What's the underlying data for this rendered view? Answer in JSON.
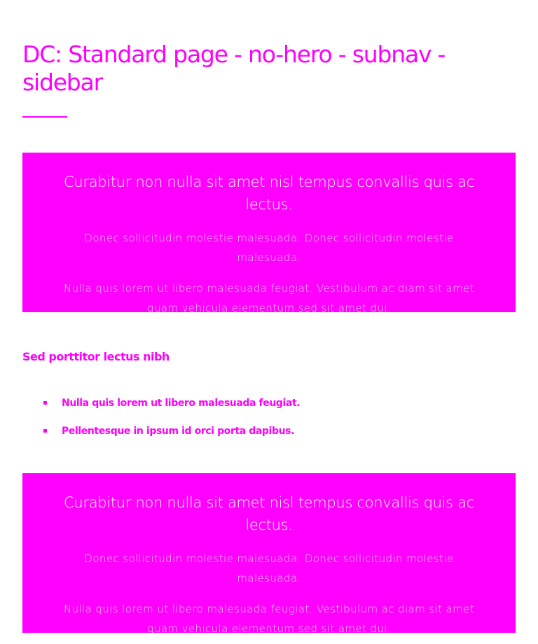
{
  "page": {
    "title": "DC: Standard page - no-hero - subnav - sidebar"
  },
  "callouts": [
    {
      "heading": "Curabitur non nulla sit amet nisl tempus convallis quis ac lectus.",
      "text1": "Donec sollicitudin molestie malesuada. Donec sollicitudin molestie malesuada.",
      "text2": "Nulla quis lorem ut libero malesuada feugiat. Vestibulum ac diam sit amet quam vehicula elementum sed sit amet dui."
    },
    {
      "heading": "Curabitur non nulla sit amet nisl tempus convallis quis ac lectus.",
      "text1": "Donec sollicitudin molestie malesuada. Donec sollicitudin molestie malesuada.",
      "text2": "Nulla quis lorem ut libero malesuada feugiat. Vestibulum ac diam sit amet quam vehicula elementum sed sit amet dui."
    }
  ],
  "section": {
    "heading": "Sed porttitor lectus nibh",
    "bullets": [
      "Nulla quis lorem ut libero malesuada feugiat.",
      "Pellentesque in ipsum id orci porta dapibus."
    ]
  },
  "colors": {
    "accent": "#ff00ff",
    "callout_text": "#ffffff",
    "callout_subtext": "#f4c9f4",
    "background": "#ffffff"
  }
}
